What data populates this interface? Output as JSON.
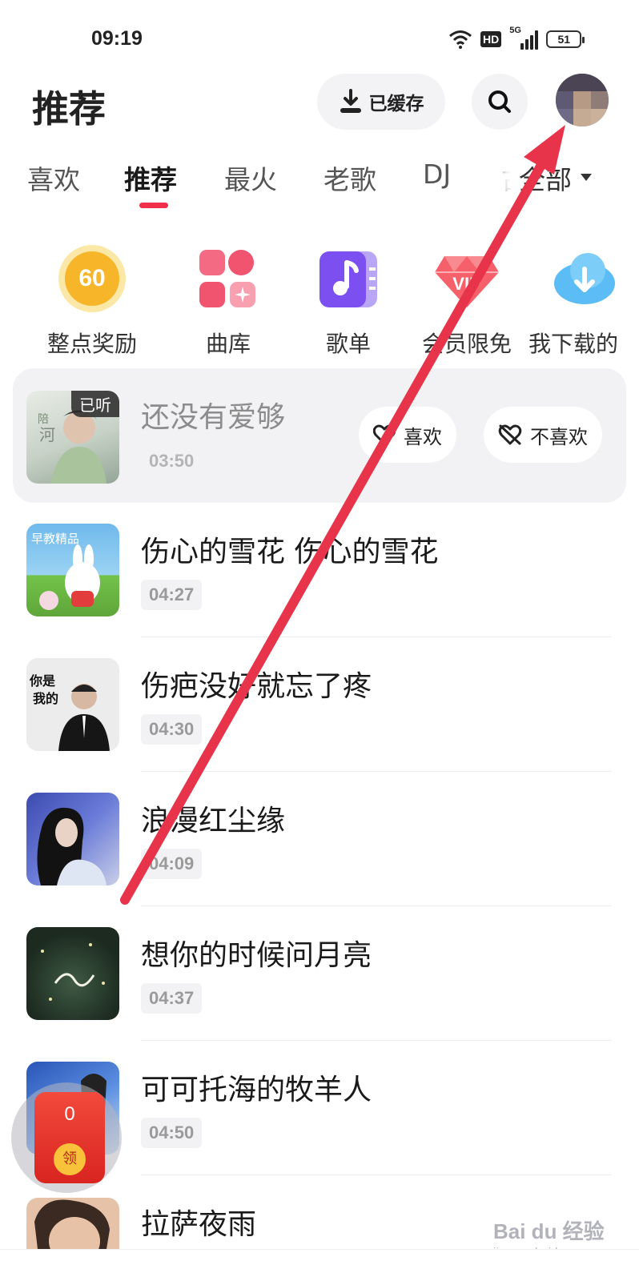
{
  "status_bar": {
    "time": "09:19",
    "hd": "HD",
    "network": "5G",
    "battery": "51"
  },
  "header": {
    "title": "推荐",
    "cached_label": "已缓存"
  },
  "tabs": [
    "喜欢",
    "推荐",
    "最火",
    "老歌",
    "DJ",
    "古"
  ],
  "tabs_active": "推荐",
  "tab_all_label": "全部",
  "shortcuts": [
    {
      "label": "整点奖励",
      "badge": "60",
      "icon": "coin-60-icon"
    },
    {
      "label": "曲库",
      "icon": "library-icon"
    },
    {
      "label": "歌单",
      "icon": "playlist-icon"
    },
    {
      "label": "会员限免",
      "badge": "VIP",
      "icon": "vip-diamond-icon"
    },
    {
      "label": "我下载的",
      "icon": "cloud-download-icon"
    }
  ],
  "listened_song": {
    "badge": "已听",
    "title": "还没有爱够",
    "duration": "03:50",
    "like_label": "喜欢",
    "dislike_label": "不喜欢"
  },
  "songs": [
    {
      "title": "伤心的雪花 伤心的雪花",
      "duration": "04:27"
    },
    {
      "title": "伤疤没好就忘了疼",
      "duration": "04:30"
    },
    {
      "title": "浪漫红尘缘",
      "duration": "04:09"
    },
    {
      "title": "想你的时候问月亮",
      "duration": "04:37"
    },
    {
      "title": "可可托海的牧羊人",
      "duration": "04:50"
    },
    {
      "title": "拉萨夜雨",
      "duration": ""
    }
  ],
  "red_packet": {
    "count": "0",
    "claim_label": "领"
  },
  "watermark": {
    "main": "Bai du 经验",
    "sub": "jingyan.baidu.com"
  },
  "colors": {
    "accent": "#f0304a",
    "annotation_arrow": "#e8344a"
  }
}
